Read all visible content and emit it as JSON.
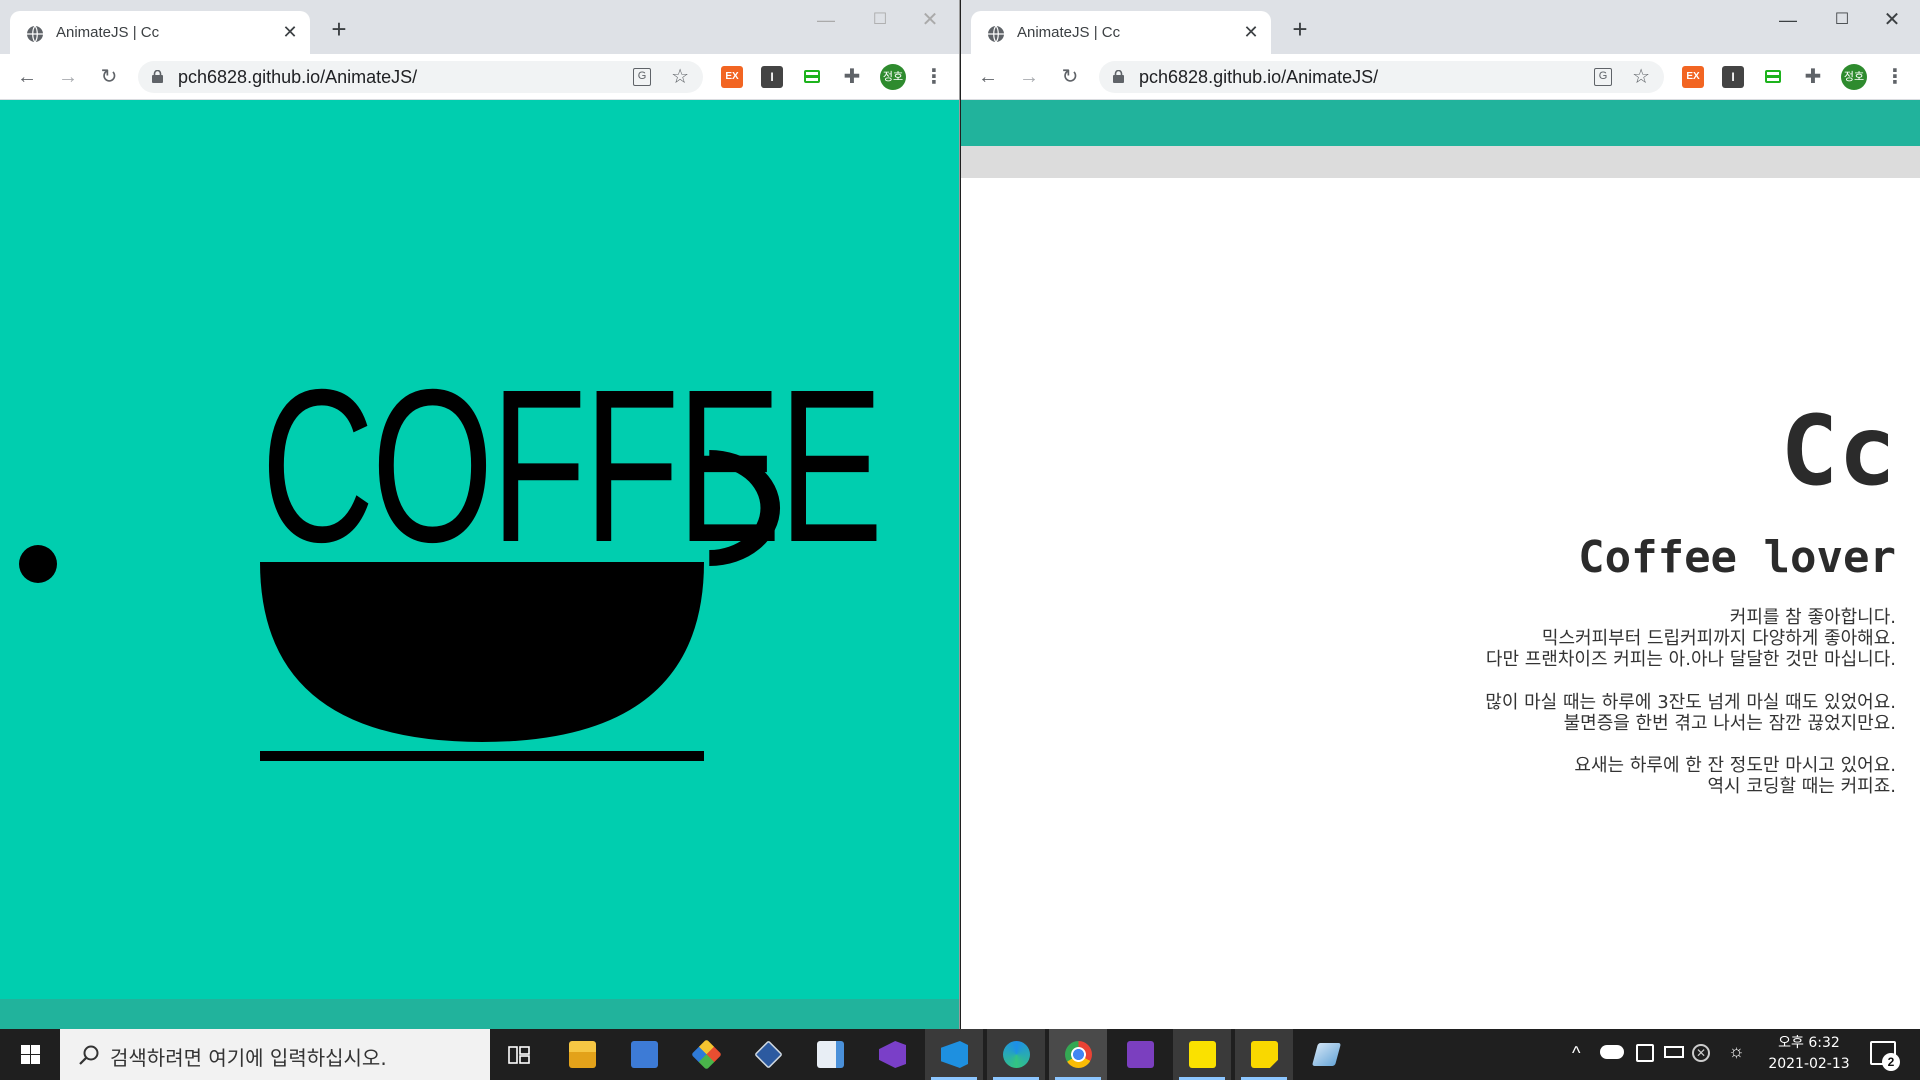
{
  "left_window": {
    "tab_title": "AnimateJS | Cc",
    "url": "pch6828.github.io/AnimateJS/",
    "coffee_word": "COFFEE"
  },
  "right_window": {
    "tab_title": "AnimateJS | Cc",
    "url": "pch6828.github.io/AnimateJS/",
    "heading": "Cc",
    "subtitle": "Coffee lover",
    "paragraphs": [
      [
        "커피를 참 좋아합니다.",
        "믹스커피부터 드립커피까지 다양하게 좋아해요.",
        "다만 프랜차이즈 커피는 아.아나 달달한 것만 마십니다."
      ],
      [
        "많이 마실 때는 하루에 3잔도 넘게 마실 때도 있었어요.",
        "불면증을 한번 겪고 나서는 잠깐 끊었지만요."
      ],
      [
        "요새는 하루에 한 잔 정도만 마시고 있어요.",
        "역시 코딩할 때는 커피죠."
      ]
    ]
  },
  "browser": {
    "new_tab": "+",
    "extensions": {
      "ex_label": "EX",
      "i_label": "I"
    },
    "profile_label": "정호"
  },
  "colors": {
    "left_bg": "#00ceaf",
    "band": "#21b39c",
    "grey_band": "#dcdcdc"
  },
  "taskbar": {
    "search_placeholder": "검색하려면 여기에 입력하십시오.",
    "apps": [
      "task-view",
      "file-explorer",
      "remote-desktop",
      "git",
      "virtualbox",
      "notepad",
      "visual-studio",
      "vscode",
      "edge",
      "chrome",
      "onenote",
      "kakaotalk",
      "sticky-notes",
      "unknown-app"
    ],
    "clock_time": "오후 6:32",
    "clock_date": "2021-02-13",
    "notification_count": "2"
  }
}
